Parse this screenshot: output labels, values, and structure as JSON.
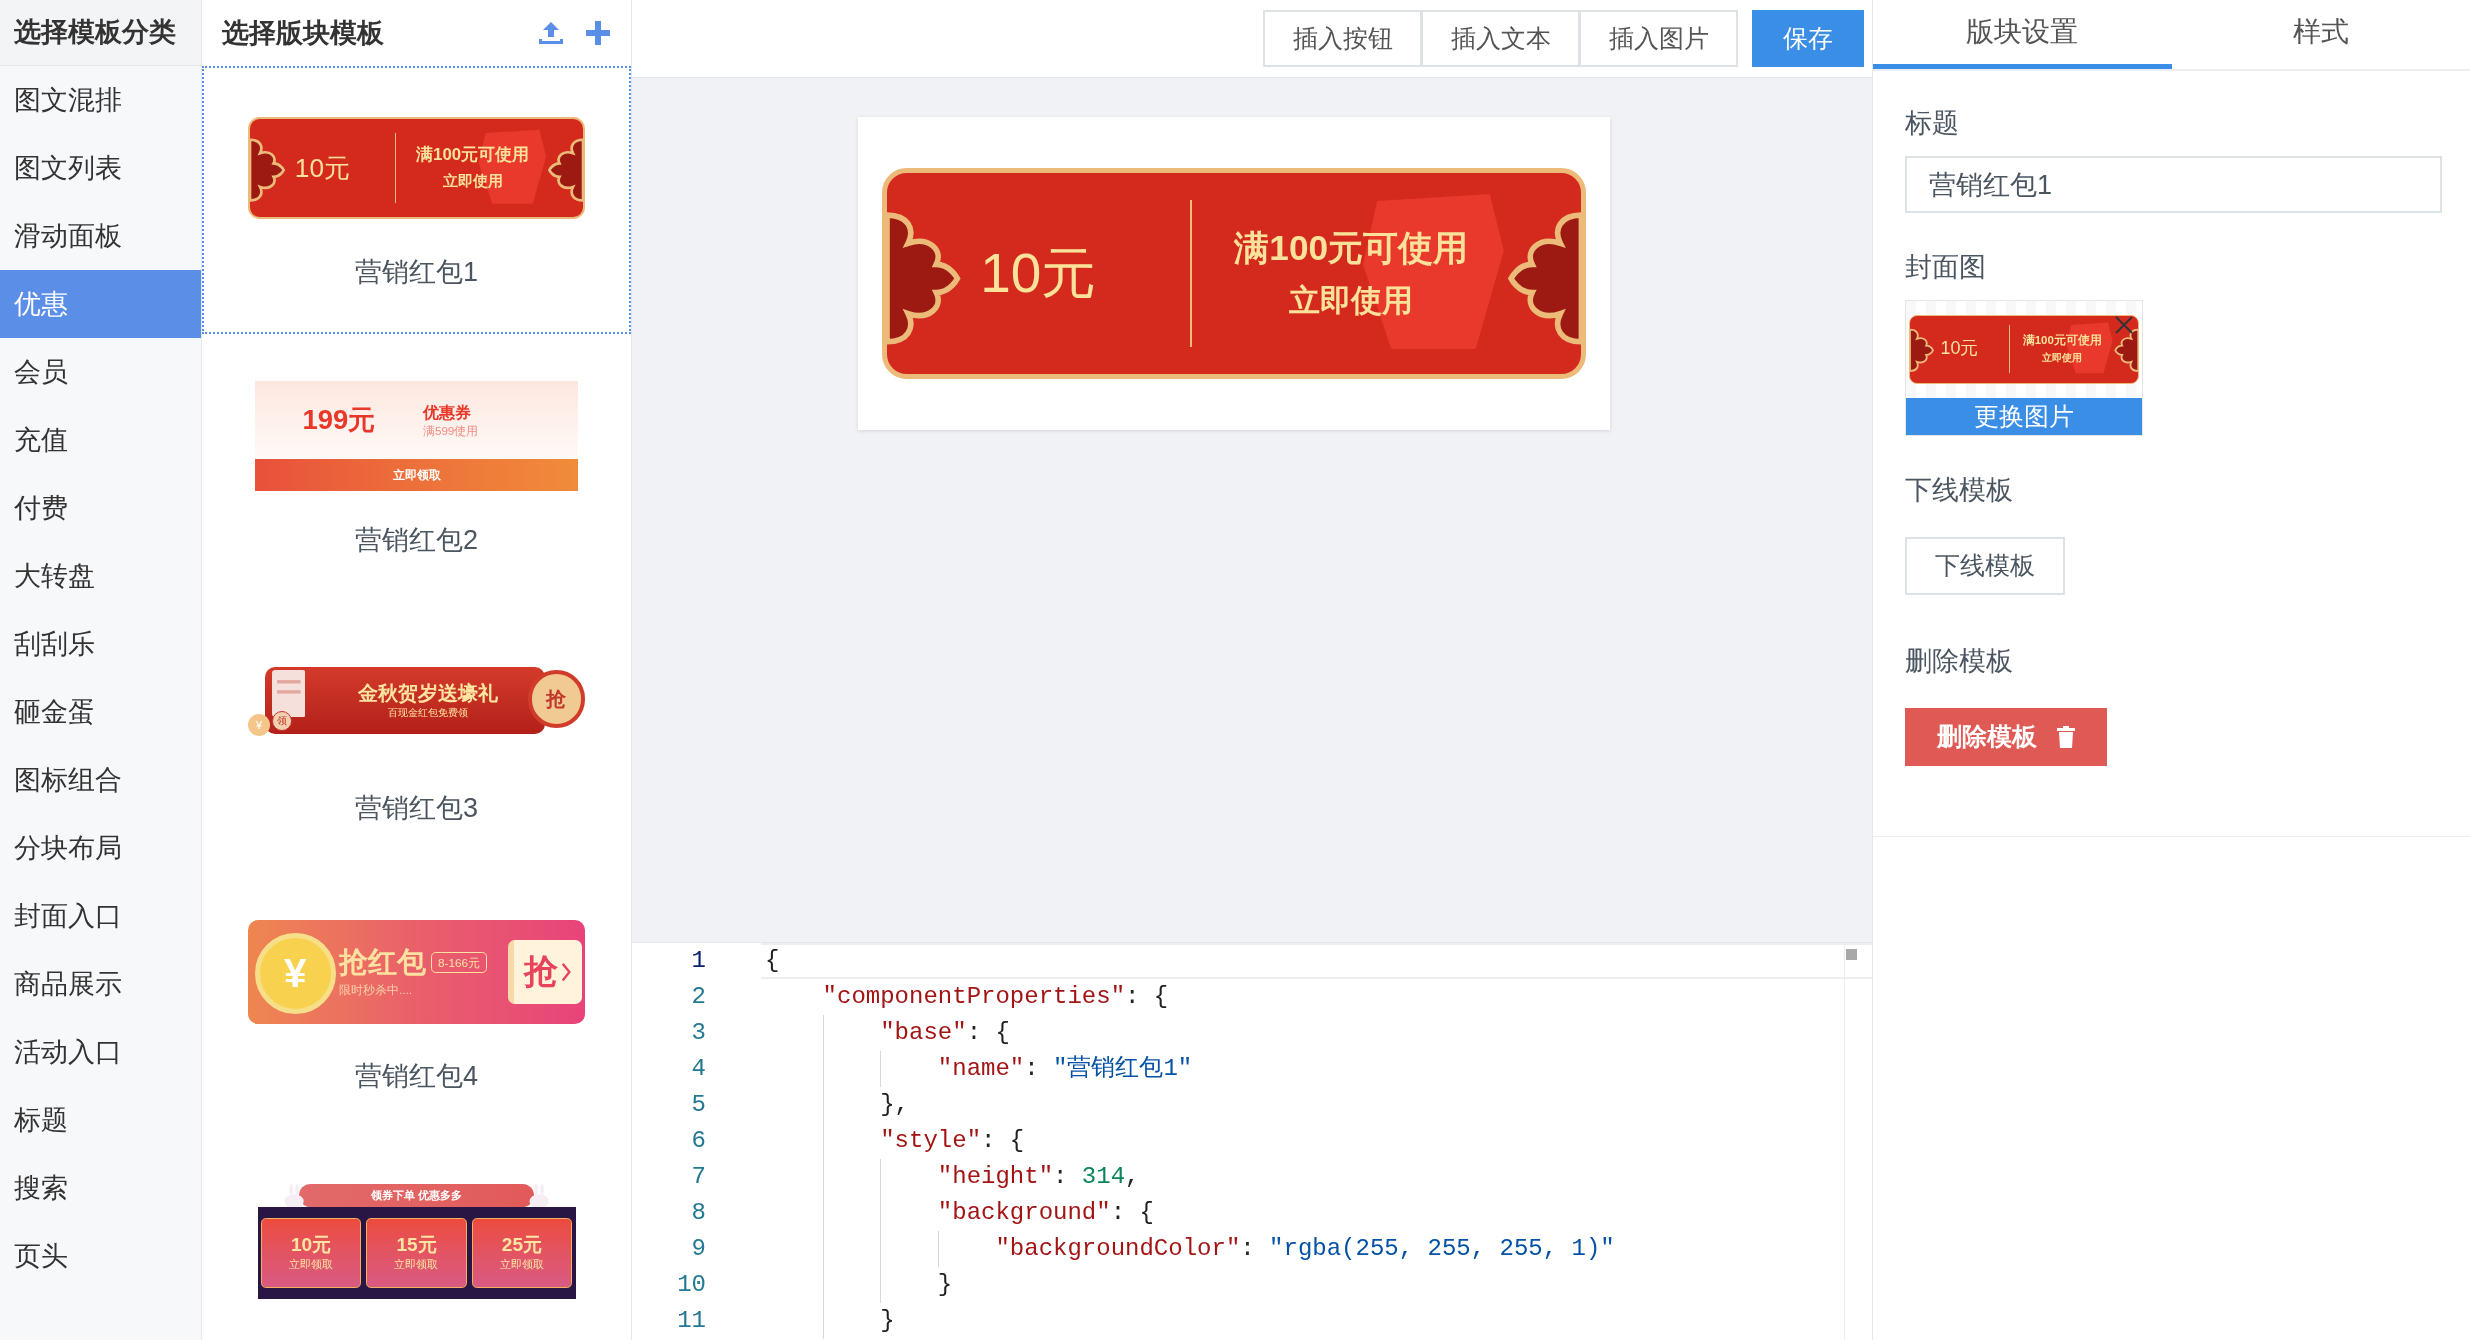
{
  "sidebar": {
    "title": "选择模板分类",
    "items": [
      {
        "label": "图文混排",
        "selected": false
      },
      {
        "label": "图文列表",
        "selected": false
      },
      {
        "label": "滑动面板",
        "selected": false
      },
      {
        "label": "优惠",
        "selected": true
      },
      {
        "label": "会员",
        "selected": false
      },
      {
        "label": "充值",
        "selected": false
      },
      {
        "label": "付费",
        "selected": false
      },
      {
        "label": "大转盘",
        "selected": false
      },
      {
        "label": "刮刮乐",
        "selected": false
      },
      {
        "label": "砸金蛋",
        "selected": false
      },
      {
        "label": "图标组合",
        "selected": false
      },
      {
        "label": "分块布局",
        "selected": false
      },
      {
        "label": "封面入口",
        "selected": false
      },
      {
        "label": "商品展示",
        "selected": false
      },
      {
        "label": "活动入口",
        "selected": false
      },
      {
        "label": "标题",
        "selected": false
      },
      {
        "label": "搜索",
        "selected": false
      },
      {
        "label": "页头",
        "selected": false
      }
    ]
  },
  "templates": {
    "title": "选择版块模板",
    "items": [
      {
        "label": "营销红包1",
        "selected": true,
        "banner": {
          "kind": "fu",
          "amount": "10元",
          "condition": "满100元可使用",
          "action": "立即使用"
        }
      },
      {
        "label": "营销红包2",
        "selected": false,
        "banner": {
          "kind": "coupon",
          "amount": "199元",
          "title": "优惠券",
          "condition": "满599使用",
          "action": "立即领取"
        }
      },
      {
        "label": "营销红包3",
        "selected": false,
        "banner": {
          "kind": "ribbon",
          "title": "金秋贺岁送壕礼",
          "subtitle": "百现金红包免费领",
          "badge": "抢",
          "coin": "¥",
          "stamp": "领"
        }
      },
      {
        "label": "营销红包4",
        "selected": false,
        "banner": {
          "kind": "grab",
          "coin": "¥",
          "title": "抢红包",
          "range": "8-166元",
          "subtitle": "限时秒杀中....",
          "action": "抢"
        }
      },
      {
        "selected": false,
        "banner": {
          "kind": "rabbit",
          "title": "领券下单 优惠多多",
          "offers": [
            {
              "amount": "10元",
              "action": "立即领取"
            },
            {
              "amount": "15元",
              "action": "立即领取"
            },
            {
              "amount": "25元",
              "action": "立即领取"
            }
          ]
        }
      }
    ]
  },
  "toolbar": {
    "buttons": [
      {
        "label": "插入按钮",
        "kind": "default"
      },
      {
        "label": "插入文本",
        "kind": "default"
      },
      {
        "label": "插入图片",
        "kind": "default"
      },
      {
        "label": "保存",
        "kind": "primary"
      }
    ]
  },
  "preview": {
    "banner": {
      "kind": "fu",
      "amount": "10元",
      "condition": "满100元可使用",
      "action": "立即使用"
    }
  },
  "editor": {
    "lines": [
      {
        "number": "1",
        "active": true,
        "tokens": [
          {
            "kind": "punct",
            "text": "{"
          }
        ]
      },
      {
        "number": "2",
        "active": false,
        "tokens": [
          {
            "kind": "key",
            "text": "    \"componentProperties\""
          },
          {
            "kind": "punct",
            "text": ": {"
          }
        ]
      },
      {
        "number": "3",
        "active": false,
        "tokens": [
          {
            "kind": "key",
            "text": "        \"base\""
          },
          {
            "kind": "punct",
            "text": ": {"
          }
        ]
      },
      {
        "number": "4",
        "active": false,
        "tokens": [
          {
            "kind": "key",
            "text": "            \"name\""
          },
          {
            "kind": "punct",
            "text": ": "
          },
          {
            "kind": "string",
            "text": "\"营销红包1\""
          }
        ]
      },
      {
        "number": "5",
        "active": false,
        "tokens": [
          {
            "kind": "punct",
            "text": "        },"
          }
        ]
      },
      {
        "number": "6",
        "active": false,
        "tokens": [
          {
            "kind": "key",
            "text": "        \"style\""
          },
          {
            "kind": "punct",
            "text": ": {"
          }
        ]
      },
      {
        "number": "7",
        "active": false,
        "tokens": [
          {
            "kind": "key",
            "text": "            \"height\""
          },
          {
            "kind": "punct",
            "text": ": "
          },
          {
            "kind": "number",
            "text": "314"
          },
          {
            "kind": "punct",
            "text": ","
          }
        ]
      },
      {
        "number": "8",
        "active": false,
        "tokens": [
          {
            "kind": "key",
            "text": "            \"background\""
          },
          {
            "kind": "punct",
            "text": ": {"
          }
        ]
      },
      {
        "number": "9",
        "active": false,
        "tokens": [
          {
            "kind": "key",
            "text": "                \"backgroundColor\""
          },
          {
            "kind": "punct",
            "text": ": "
          },
          {
            "kind": "string",
            "text": "\"rgba(255, 255, 255, 1)\""
          }
        ]
      },
      {
        "number": "10",
        "active": false,
        "tokens": [
          {
            "kind": "punct",
            "text": "            }"
          }
        ]
      },
      {
        "number": "11",
        "active": false,
        "tokens": [
          {
            "kind": "punct",
            "text": "        }"
          }
        ]
      }
    ]
  },
  "settings": {
    "tabs": [
      {
        "label": "版块设置",
        "selected": true
      },
      {
        "label": "样式",
        "selected": false
      }
    ],
    "title_label": "标题",
    "title_value": "营销红包1",
    "cover_label": "封面图",
    "cover": {
      "kind": "fu",
      "amount": "10元",
      "condition": "满100元可使用",
      "action": "立即使用"
    },
    "cover_button": "更换图片",
    "offline_label": "下线模板",
    "offline_button": "下线模板",
    "delete_label": "删除模板",
    "delete_button": "删除模板"
  }
}
